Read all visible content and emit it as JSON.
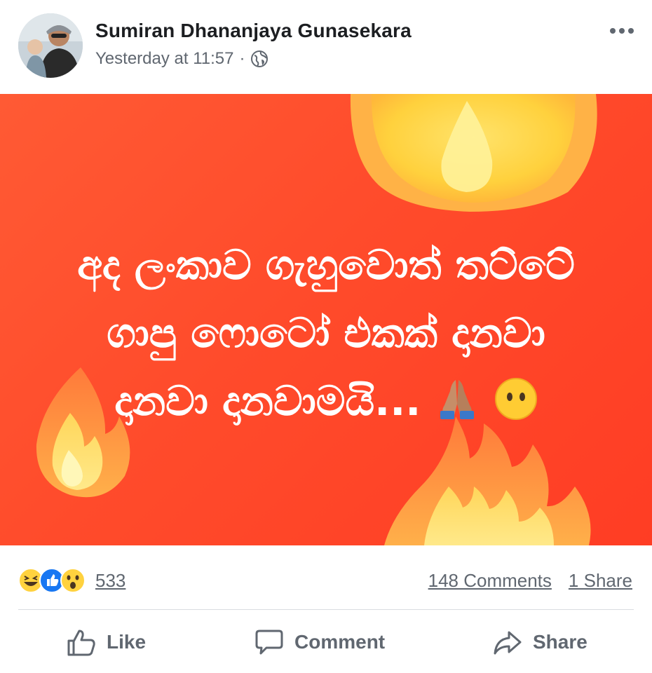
{
  "post": {
    "author": "Sumiran Dhananjaya Gunasekara",
    "timestamp": "Yesterday at 11:57",
    "separator": "·",
    "privacy_icon": "globe-icon",
    "more_icon": "more-horizontal-icon"
  },
  "image": {
    "text_lines": [
      "අද ලංකාව ගැහුවොත් තට්ටේ",
      "ගාපු ෆොටෝ එකක් දානවා",
      "දානවා දානවාමයි..."
    ],
    "emojis": [
      "folded-hands-emoji",
      "face-without-mouth-emoji"
    ],
    "colors": {
      "background": "#ff4b2b",
      "text": "#ffffff"
    }
  },
  "engagement": {
    "reaction_icons": [
      "haha-reaction-icon",
      "like-reaction-icon",
      "wow-reaction-icon"
    ],
    "reaction_count": "533",
    "comments": "148 Comments",
    "shares": "1 Share"
  },
  "actions": {
    "like": "Like",
    "comment": "Comment",
    "share": "Share"
  }
}
